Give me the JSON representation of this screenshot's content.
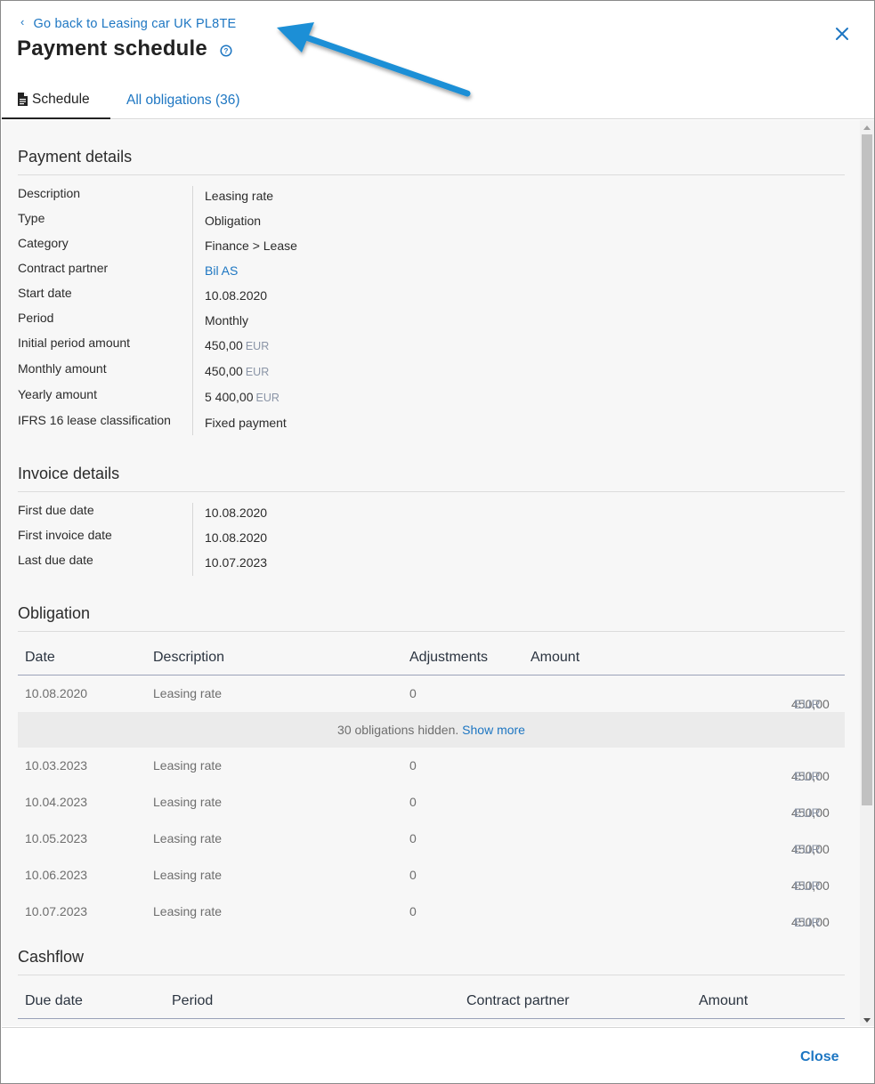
{
  "header": {
    "back_label": "Go back to Leasing car UK PL8TE",
    "title": "Payment schedule"
  },
  "tabs": [
    {
      "label": "Schedule",
      "active": true
    },
    {
      "label": "All obligations (36)",
      "active": false
    }
  ],
  "payment_details": {
    "title": "Payment details",
    "rows": [
      {
        "label": "Description",
        "value": "Leasing rate"
      },
      {
        "label": "Type",
        "value": "Obligation"
      },
      {
        "label": "Category",
        "value": "Finance > Lease"
      },
      {
        "label": "Contract partner",
        "value": "Bil AS"
      },
      {
        "label": "Start date",
        "value": "10.08.2020"
      },
      {
        "label": "Period",
        "value": "Monthly"
      },
      {
        "label": "Initial period amount",
        "value": "450,00",
        "currency": "EUR"
      },
      {
        "label": "Monthly amount",
        "value": "450,00",
        "currency": "EUR"
      },
      {
        "label": "Yearly amount",
        "value": "5 400,00",
        "currency": "EUR"
      },
      {
        "label": "IFRS 16 lease classification",
        "value": "Fixed payment"
      }
    ]
  },
  "invoice_details": {
    "title": "Invoice details",
    "rows": [
      {
        "label": "First due date",
        "value": "10.08.2020"
      },
      {
        "label": "First invoice date",
        "value": "10.08.2020"
      },
      {
        "label": "Last due date",
        "value": "10.07.2023"
      }
    ]
  },
  "obligation": {
    "title": "Obligation",
    "columns": [
      "Date",
      "Description",
      "Adjustments",
      "Amount"
    ],
    "first_row": {
      "date": "10.08.2020",
      "description": "Leasing rate",
      "adjustments": "0",
      "amount": "450,00",
      "currency": "EUR"
    },
    "hidden_text": "30 obligations hidden.",
    "show_more": "Show more",
    "rows": [
      {
        "date": "10.03.2023",
        "description": "Leasing rate",
        "adjustments": "0",
        "amount": "450,00",
        "currency": "EUR"
      },
      {
        "date": "10.04.2023",
        "description": "Leasing rate",
        "adjustments": "0",
        "amount": "450,00",
        "currency": "EUR"
      },
      {
        "date": "10.05.2023",
        "description": "Leasing rate",
        "adjustments": "0",
        "amount": "450,00",
        "currency": "EUR"
      },
      {
        "date": "10.06.2023",
        "description": "Leasing rate",
        "adjustments": "0",
        "amount": "450,00",
        "currency": "EUR"
      },
      {
        "date": "10.07.2023",
        "description": "Leasing rate",
        "adjustments": "0",
        "amount": "450,00",
        "currency": "EUR"
      }
    ]
  },
  "cashflow": {
    "title": "Cashflow",
    "columns": [
      "Due date",
      "Period",
      "Contract partner",
      "Amount"
    ]
  },
  "footer": {
    "close_label": "Close"
  },
  "colors": {
    "accent": "#1d76c2",
    "annotation_arrow": "#1a8fd6"
  }
}
